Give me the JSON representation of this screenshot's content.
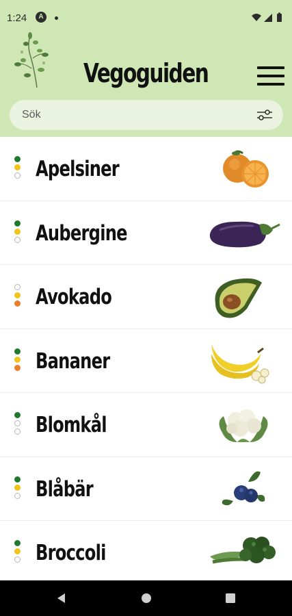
{
  "status": {
    "time": "1:24",
    "badge": "A"
  },
  "app": {
    "title": "Vegoguiden"
  },
  "search": {
    "placeholder": "Sök"
  },
  "colors": {
    "header": "#cfe7b4",
    "green": "#1f7a2e",
    "yellow": "#f0c419",
    "orange": "#e8812a",
    "empty": "#ffffff"
  },
  "items": [
    {
      "label": "Apelsiner",
      "dots": [
        "green",
        "yellow",
        "empty"
      ],
      "icon": "orange-fruit-icon"
    },
    {
      "label": "Aubergine",
      "dots": [
        "green",
        "yellow",
        "empty"
      ],
      "icon": "eggplant-icon"
    },
    {
      "label": "Avokado",
      "dots": [
        "empty",
        "yellow",
        "orange"
      ],
      "icon": "avocado-icon"
    },
    {
      "label": "Bananer",
      "dots": [
        "green",
        "yellow",
        "orange"
      ],
      "icon": "banana-icon"
    },
    {
      "label": "Blomkål",
      "dots": [
        "green",
        "empty",
        "empty"
      ],
      "icon": "cauliflower-icon"
    },
    {
      "label": "Blåbär",
      "dots": [
        "green",
        "yellow",
        "empty"
      ],
      "icon": "blueberry-icon"
    },
    {
      "label": "Broccoli",
      "dots": [
        "green",
        "yellow",
        "empty"
      ],
      "icon": "broccoli-icon"
    }
  ]
}
